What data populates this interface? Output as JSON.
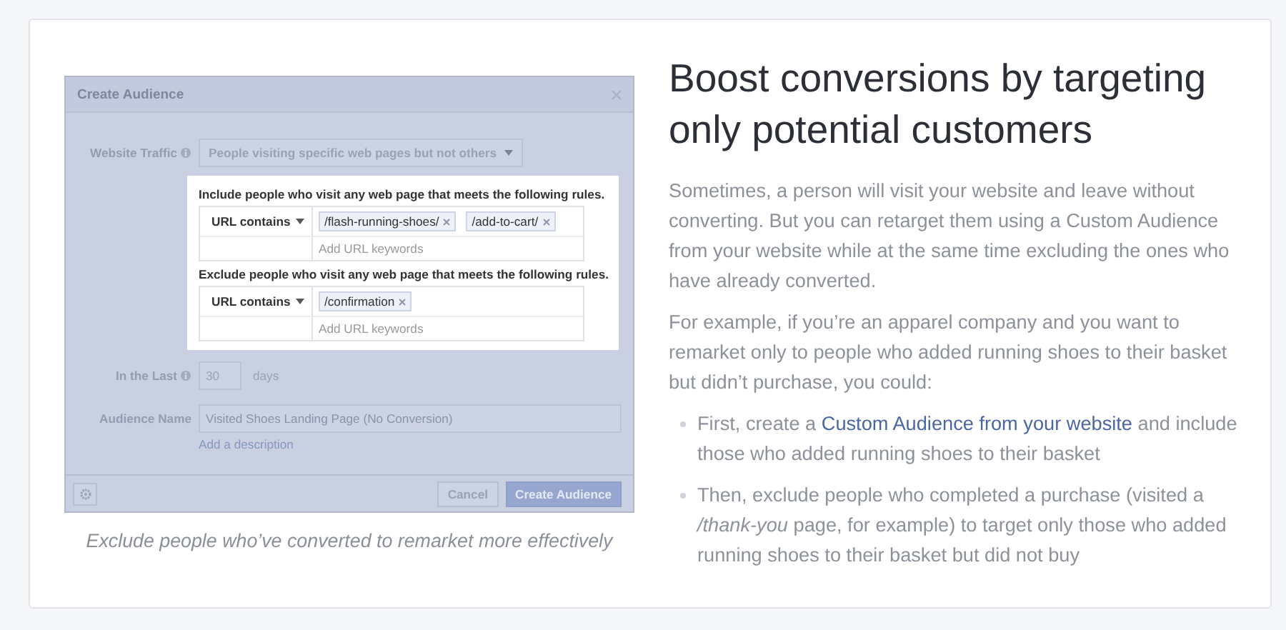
{
  "figure": {
    "dialog": {
      "title": "Create Audience",
      "traffic": {
        "label": "Website Traffic",
        "value": "People visiting specific web pages but not others"
      },
      "rule_groups": [
        {
          "heading": "Include people who visit any web page that meets the following rules.",
          "operator": "URL contains",
          "tags": [
            "/flash-running-shoes/",
            "/add-to-cart/"
          ],
          "placeholder": "Add URL keywords"
        },
        {
          "heading": "Exclude people who visit any web page that meets the following rules.",
          "operator": "URL contains",
          "tags": [
            "/confirmation"
          ],
          "placeholder": "Add URL keywords"
        }
      ],
      "duration": {
        "label": "In the Last",
        "value": "30",
        "unit": "days"
      },
      "audience_name": {
        "label": "Audience Name",
        "value": "Visited Shoes Landing Page (No Conversion)",
        "link": "Add a description"
      },
      "buttons": [
        {
          "label": "Cancel",
          "kind": "secondary"
        },
        {
          "label": "Create Audience",
          "kind": "primary"
        }
      ]
    },
    "caption": "Exclude people who’ve converted to remarket more effectively"
  },
  "article": {
    "heading": "Boost conversions by targeting only potential customers",
    "paragraphs": [
      "Sometimes, a person will visit your website and leave without converting. But you can retarget them using a Custom Audience from your website while at the same time excluding the ones who have already converted.",
      "For example, if you’re an apparel company and you want to remarket only to people who added running shoes to their basket but didn’t purchase, you could:"
    ],
    "bullets": [
      {
        "before": "First, create a ",
        "link": "Custom Audience from your website",
        "after": " and include those who added running shoes to their basket"
      },
      {
        "before": "Then, exclude people who completed a purchase (visited a */thank-you* page, for example) to target only those who added running shoes to their basket but did not buy"
      }
    ]
  }
}
